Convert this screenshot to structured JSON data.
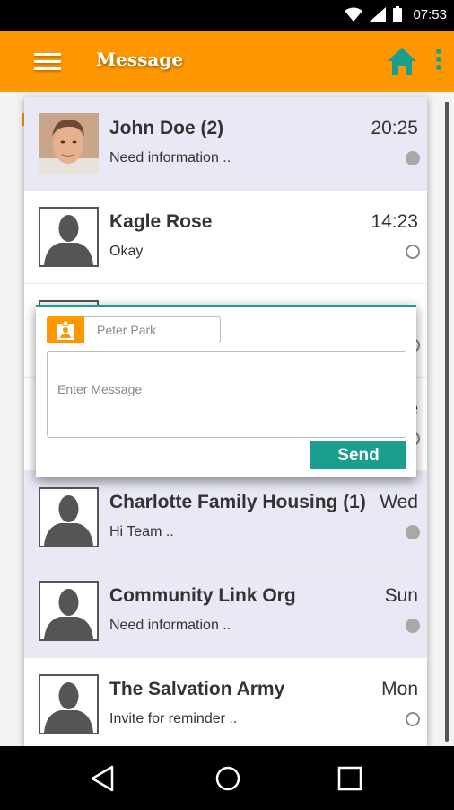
{
  "status_bar": {
    "time": "07:53"
  },
  "app_bar": {
    "title": "Message"
  },
  "conversations": [
    {
      "name": "John Doe (2)",
      "time": "20:25",
      "snippet": "Need information ..",
      "read": false,
      "avatar": "photo"
    },
    {
      "name": "Kagle Rose",
      "time": "14:23",
      "snippet": "Okay",
      "read": true,
      "avatar": "placeholder"
    },
    {
      "name": "",
      "time": "",
      "snippet": "",
      "read": true,
      "avatar": "placeholder"
    },
    {
      "name": "",
      "time": "e",
      "snippet": "",
      "read": true,
      "avatar": "placeholder"
    },
    {
      "name": "Charlotte Family Housing (1)",
      "time": "Wed",
      "snippet": "Hi Team ..",
      "read": false,
      "avatar": "placeholder"
    },
    {
      "name": "Community Link Org",
      "time": "Sun",
      "snippet": "Need information ..",
      "read": false,
      "avatar": "placeholder"
    },
    {
      "name": "The Salvation Army",
      "time": "Mon",
      "snippet": "Invite for reminder ..",
      "read": true,
      "avatar": "placeholder"
    }
  ],
  "compose": {
    "recipient": "Peter Park",
    "message_placeholder": "Enter Message",
    "send_label": "Send"
  },
  "colors": {
    "app_bar": "#ff9800",
    "accent": "#1a9e8e",
    "unread_row": "#e8e9f4"
  }
}
